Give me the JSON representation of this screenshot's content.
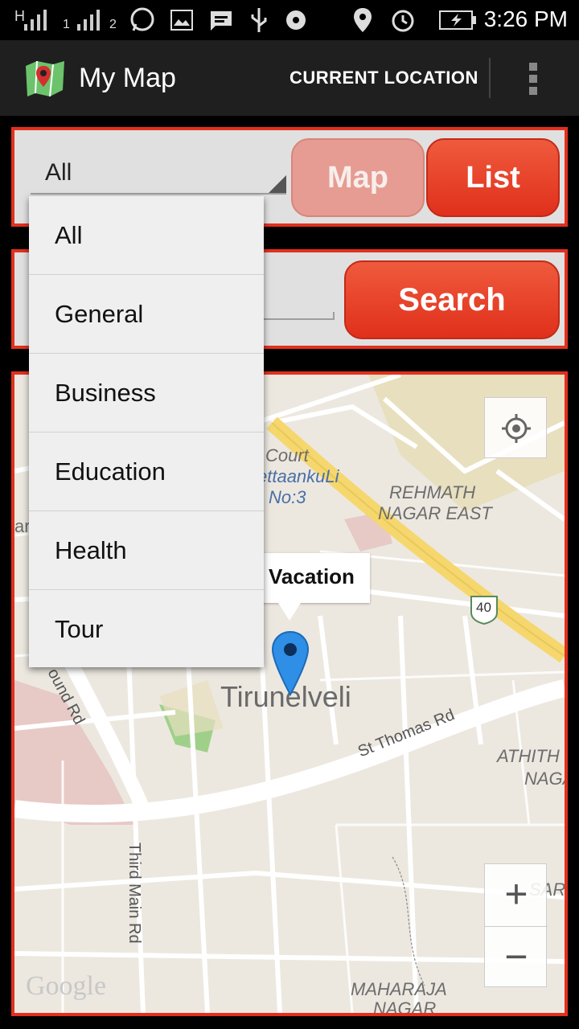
{
  "status_bar": {
    "time": "3:26 PM",
    "network_label": "H",
    "sim1": "1",
    "sim2": "2"
  },
  "app_bar": {
    "title": "My Map",
    "action": "CURRENT LOCATION"
  },
  "filter": {
    "selected": "All",
    "map_button": "Map",
    "list_button": "List"
  },
  "search": {
    "value": "",
    "button": "Search"
  },
  "dropdown": {
    "items": [
      "All",
      "General",
      "Business",
      "Education",
      "Health",
      "Tour"
    ]
  },
  "map": {
    "labels": {
      "court": "Court",
      "pettaankuli": "ettaankuLi",
      "no3": "No:3",
      "rehmath": "REHMATH",
      "nagar_east": "NAGAR EAST",
      "athith": "ATHITH",
      "naga": "NAGA",
      "saranya": "SARANYA",
      "maharaja": "MAHARAJA",
      "nagar": "NAGAR",
      "ar": "ar"
    },
    "city": "Tirunelveli",
    "roads": {
      "st_thomas": "St Thomas Rd",
      "third_main": "Third Main Rd",
      "round_rd": "ound Rd"
    },
    "highway_shield": "40",
    "info_window": "Vacation",
    "google": "Google",
    "zoom_in": "+",
    "zoom_out": "−"
  },
  "colors": {
    "accent_red": "#e2301e",
    "button_red": "#e8442a",
    "disabled_button": "#e69c92",
    "marker_blue": "#2f8ee6",
    "highway_yellow": "#f5d76e"
  }
}
